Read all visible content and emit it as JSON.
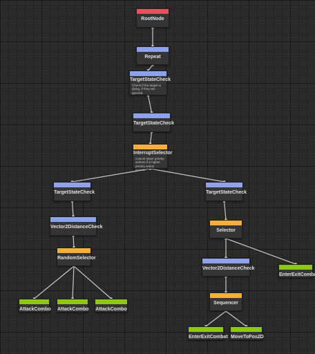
{
  "colors": {
    "root": "#e8505b",
    "decorator": "#8ea3ec",
    "composite": "#f5ad3c",
    "action": "#8ec618",
    "wire": "#c9c9c9"
  },
  "nodes": [
    {
      "id": "root",
      "title": "RootNode",
      "kind": "root"
    },
    {
      "id": "repeat",
      "title": "Repeat",
      "kind": "decorator"
    },
    {
      "id": "tsc1",
      "title": "TargetStateCheck",
      "kind": "decorator",
      "desc": "Check if the target is\ndying, if they are\nignored."
    },
    {
      "id": "tsc2",
      "title": "TargetStateCheck",
      "kind": "decorator"
    },
    {
      "id": "interrupt",
      "title": "InterruptSelector",
      "kind": "composite",
      "desc": "Cancel lower priority\nactions if a higher\npriority action occurs."
    },
    {
      "id": "tsc3",
      "title": "TargetStateCheck",
      "kind": "decorator"
    },
    {
      "id": "tsc4",
      "title": "TargetStateCheck",
      "kind": "decorator"
    },
    {
      "id": "v2dc1",
      "title": "Vector2DistanceCheck",
      "kind": "decorator"
    },
    {
      "id": "selector",
      "title": "Selector",
      "kind": "composite"
    },
    {
      "id": "rand",
      "title": "RandomSelector",
      "kind": "composite"
    },
    {
      "id": "v2dc2",
      "title": "Vector2DistanceCheck",
      "kind": "decorator"
    },
    {
      "id": "eec1",
      "title": "EnterExitCombat",
      "kind": "action"
    },
    {
      "id": "ac1",
      "title": "AttackCombo",
      "kind": "action"
    },
    {
      "id": "ac2",
      "title": "AttackCombo",
      "kind": "action"
    },
    {
      "id": "ac3",
      "title": "AttackCombo",
      "kind": "action"
    },
    {
      "id": "seq",
      "title": "Sequencer",
      "kind": "composite"
    },
    {
      "id": "eec2",
      "title": "EnterExitCombat",
      "kind": "action"
    },
    {
      "id": "move",
      "title": "MoveToPos2D",
      "kind": "action"
    }
  ],
  "edges": [
    [
      "root",
      "repeat"
    ],
    [
      "repeat",
      "tsc1"
    ],
    [
      "tsc1",
      "tsc2"
    ],
    [
      "tsc2",
      "interrupt"
    ],
    [
      "interrupt",
      "tsc3"
    ],
    [
      "interrupt",
      "tsc4"
    ],
    [
      "tsc3",
      "v2dc1"
    ],
    [
      "v2dc1",
      "rand"
    ],
    [
      "rand",
      "ac1"
    ],
    [
      "rand",
      "ac2"
    ],
    [
      "rand",
      "ac3"
    ],
    [
      "tsc4",
      "selector"
    ],
    [
      "selector",
      "v2dc2"
    ],
    [
      "selector",
      "eec1"
    ],
    [
      "v2dc2",
      "seq"
    ],
    [
      "seq",
      "eec2"
    ],
    [
      "seq",
      "move"
    ]
  ]
}
